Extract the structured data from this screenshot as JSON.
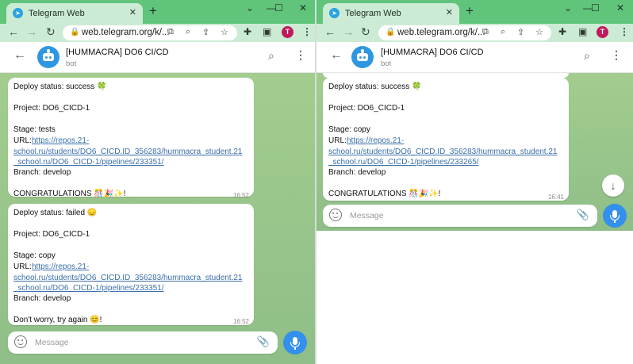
{
  "left_window": {
    "browser": {
      "tab_title": "Telegram Web",
      "url": "web.telegram.org/k/..."
    },
    "chat": {
      "title": "[HUMMACRA] DO6 CI/CD",
      "subtitle": "bot",
      "messages": [
        {
          "status": "Deploy status: success 🍀",
          "project": "Project: DO6_CICD-1",
          "stage": "Stage: tests",
          "url_label": "URL: ",
          "url_line1": "https://repos.21-",
          "url_line2": "school.ru/students/DO6_CICD.ID_356283/hummacra_student.21",
          "url_line3": "_school.ru/DO6_CICD-1/pipelines/233351/",
          "branch": "Branch: develop",
          "footer": " CONGRATULATIONS 🎊🎉✨!",
          "time": "16:52"
        },
        {
          "status": "Deploy status: failed 😞",
          "project": "Project: DO6_CICD-1",
          "stage": "Stage: copy",
          "url_label": "URL: ",
          "url_line1": "https://repos.21-",
          "url_line2": "school.ru/students/DO6_CICD.ID_356283/hummacra_student.21",
          "url_line3": "_school.ru/DO6_CICD-1/pipelines/233351/",
          "branch": "Branch: develop",
          "footer": " Don't worry, try again 😊!",
          "time": "16:52"
        }
      ],
      "composer_placeholder": "Message"
    }
  },
  "right_window": {
    "browser": {
      "tab_title": "Telegram Web",
      "url": "web.telegram.org/k/..."
    },
    "chat": {
      "title": "[HUMMACRA] DO6 CI/CD",
      "subtitle": "bot",
      "messages": [
        {
          "status": "Deploy status: success 🍀",
          "project": "Project: DO6_CICD-1",
          "stage": "Stage: copy",
          "url_label": "URL: ",
          "url_line1": "https://repos.21-",
          "url_line2": "school.ru/students/DO6_CICD.ID_356283/hummacra_student.21",
          "url_line3": "_school.ru/DO6_CICD-1/pipelines/233265/",
          "branch": "Branch: develop",
          "footer": " CONGRATULATIONS 🎊🎉✨!",
          "time": "16:41"
        }
      ],
      "composer_placeholder": "Message"
    }
  },
  "icons": {
    "favicon": "telegram-icon",
    "newtab": "plus-icon",
    "back": "arrow-left-icon",
    "forward": "arrow-right-icon",
    "reload": "reload-icon",
    "lock": "lock-icon",
    "search": "search-icon",
    "more": "kebab-icon",
    "attach": "paperclip-icon",
    "mic": "microphone-icon",
    "scroll_down": "arrow-down-icon",
    "emoji": "smile-icon"
  },
  "colors": {
    "chrome_frame": "#61c47b",
    "chrome_toolbar": "#ccebd4",
    "link": "#3a6fa8",
    "mic": "#3390ec",
    "chat_bg": "#8fbf86"
  }
}
